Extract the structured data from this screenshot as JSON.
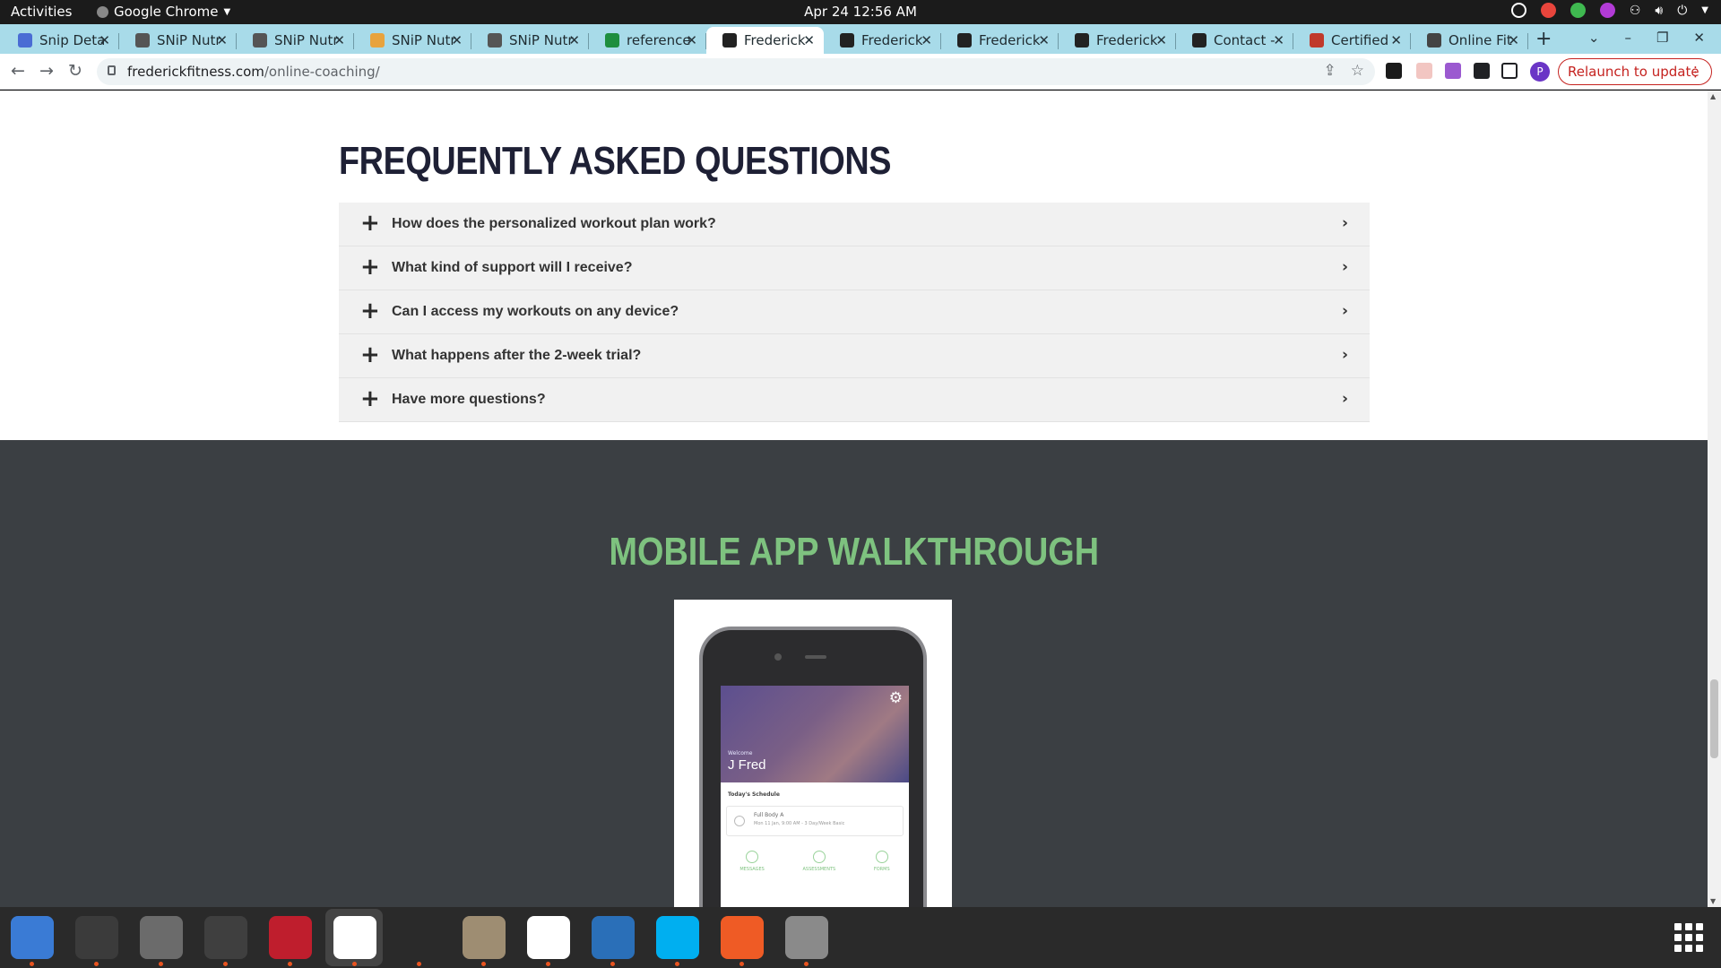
{
  "system": {
    "activities": "Activities",
    "app_menu": "Google Chrome",
    "clock": "Apr 24  12:56 AM"
  },
  "tabs": [
    {
      "title": "Snip Deta",
      "favicon_color": "#4a6cd4"
    },
    {
      "title": "SNiP Nutr",
      "favicon_color": "#555555"
    },
    {
      "title": "SNiP Nutr",
      "favicon_color": "#555555"
    },
    {
      "title": "SNiP Nutr",
      "favicon_color": "#e8a33d"
    },
    {
      "title": "SNiP Nutr",
      "favicon_color": "#555555"
    },
    {
      "title": "reference",
      "favicon_color": "#1e8e3e"
    },
    {
      "title": "Frederick",
      "favicon_color": "#222222",
      "active": true
    },
    {
      "title": "Frederick",
      "favicon_color": "#222222"
    },
    {
      "title": "Frederick",
      "favicon_color": "#222222"
    },
    {
      "title": "Frederick",
      "favicon_color": "#222222"
    },
    {
      "title": "Contact -",
      "favicon_color": "#222222"
    },
    {
      "title": "Certified",
      "favicon_color": "#c0392b"
    },
    {
      "title": "Online Fit",
      "favicon_color": "#444444"
    }
  ],
  "omnibox": {
    "host": "frederickfitness.com",
    "path": "/online-coaching/"
  },
  "toolbar": {
    "profile_initial": "P",
    "relaunch_label": "Relaunch to update"
  },
  "page": {
    "faq_title": "FREQUENTLY ASKED QUESTIONS",
    "faq": [
      {
        "question": "How does the personalized workout plan work?"
      },
      {
        "question": "What kind of support will I receive?"
      },
      {
        "question": "Can I access my workouts on any device?"
      },
      {
        "question": "What happens after the 2-week trial?"
      },
      {
        "question": "Have more questions?"
      }
    ],
    "app_section_title": "MOBILE APP WALKTHROUGH",
    "accent_color": "#7ec27f",
    "phone_screen": {
      "welcome": "Welcome",
      "user_name": "J Fred",
      "schedule_label": "Today's Schedule",
      "workout_name": "Full Body A",
      "workout_meta": "Mon 11 Jan, 9:00 AM - 3 Day/Week Basic",
      "tab_messages": "MESSAGES",
      "tab_assessments": "ASSESSMENTS",
      "tab_forms": "FORMS"
    }
  },
  "dock": [
    {
      "name": "thunderbird",
      "color": "#3a7bd5"
    },
    {
      "name": "terminal",
      "color": "#3b3b3b"
    },
    {
      "name": "calculator",
      "color": "#6b6b6b"
    },
    {
      "name": "system-monitor",
      "color": "#3f3f3f"
    },
    {
      "name": "filezilla",
      "color": "#bf1e2d"
    },
    {
      "name": "chrome",
      "color": "#ffffff"
    },
    {
      "name": "vscode",
      "color": "#2a2a2a"
    },
    {
      "name": "files",
      "color": "#9e8d72"
    },
    {
      "name": "text-editor",
      "color": "#ffffff"
    },
    {
      "name": "libreoffice-writer",
      "color": "#2a6fb8"
    },
    {
      "name": "skype",
      "color": "#00aff0"
    },
    {
      "name": "postman",
      "color": "#ef5b25"
    },
    {
      "name": "disks",
      "color": "#8a8a8a"
    }
  ]
}
